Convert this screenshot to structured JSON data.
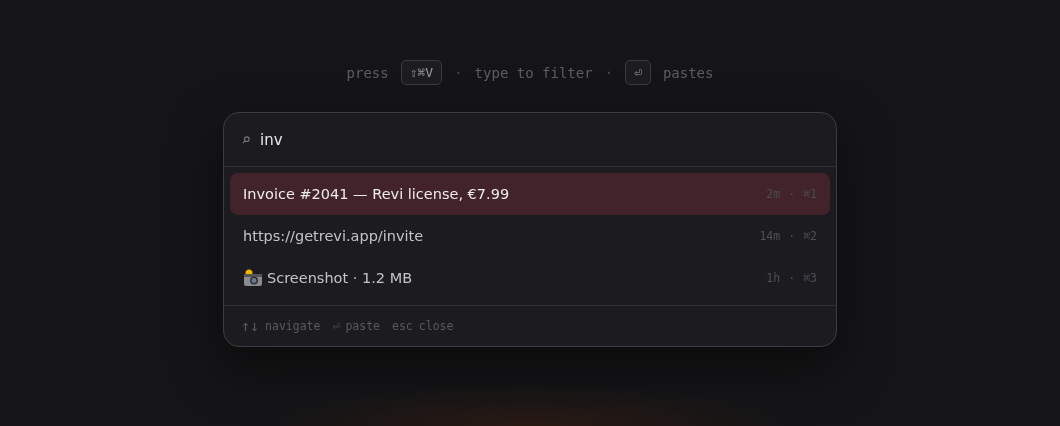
{
  "hint": [
    {
      "kind": "text",
      "text": "press"
    },
    {
      "kind": "key",
      "text": "⇧⌘V"
    },
    {
      "kind": "sep",
      "text": "·"
    },
    {
      "kind": "text",
      "text": "type to filter"
    },
    {
      "kind": "sep",
      "text": "·"
    },
    {
      "kind": "key",
      "text": "⏎"
    },
    {
      "kind": "text",
      "text": "pastes"
    }
  ],
  "search": {
    "value": "inv"
  },
  "results": [
    {
      "kind": "plain",
      "text": "Invoice #2041 — Revi license, €7.99",
      "time": "2m",
      "sep": "·",
      "shortcut": "⌘1",
      "selected": true
    },
    {
      "kind": "plain",
      "text": "https://getrevi.app/invite",
      "time": "14m",
      "sep": "·",
      "shortcut": "⌘2",
      "selected": false
    },
    {
      "kind": "image",
      "text": "Screenshot · 1.2 MB",
      "time": "1h",
      "sep": "·",
      "shortcut": "⌘3",
      "selected": false
    }
  ],
  "footer": [
    {
      "kind": "arrows",
      "key": "↑↓",
      "label": "navigate"
    },
    {
      "kind": "key",
      "key": "⏎",
      "label": "paste"
    },
    {
      "kind": "key",
      "key": "esc",
      "label": "close"
    }
  ]
}
